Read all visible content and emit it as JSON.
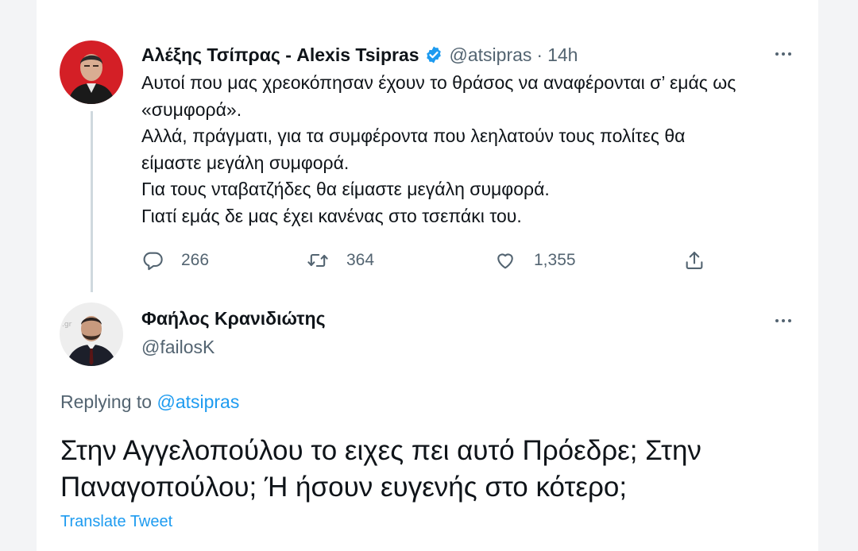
{
  "parent_tweet": {
    "display_name": "Αλέξης Τσίπρας - Alexis Tsipras",
    "verified_icon": "verified-badge-icon",
    "handle": "@atsipras",
    "separator": "·",
    "time": "14h",
    "text_lines": [
      "Αυτοί που μας χρεοκόπησαν έχουν το θράσος να αναφέρονται σ’ εμάς ως",
      "«συμφορά».",
      "Αλλά, πράγματι, για τα συμφέροντα που λεηλατούν τους πολίτες θα",
      "είμαστε μεγάλη συμφορά.",
      "Για τους νταβατζήδες θα είμαστε μεγάλη συμφορά.",
      "Γιατί εμάς δε μας έχει κανένας στο τσεπάκι του."
    ],
    "actions": {
      "reply_count": "266",
      "retweet_count": "364",
      "like_count": "1,355"
    }
  },
  "reply_tweet": {
    "display_name": "Φαήλος Κρανιδιώτης",
    "handle": "@failosK",
    "replying_prefix": "Replying to",
    "replying_to": "@atsipras",
    "text_lines": [
      "Στην Αγγελοπούλου το ειχες πει αυτό Πρόεδρε; Στην",
      "Παναγοπούλου; Ή ήσουν ευγενής στο κότερο;"
    ],
    "translate_label": "Translate Tweet"
  },
  "colors": {
    "text_primary": "#0f1419",
    "text_secondary": "#536471",
    "accent_blue": "#1d9bf0",
    "thread_line": "#cfd9de"
  }
}
